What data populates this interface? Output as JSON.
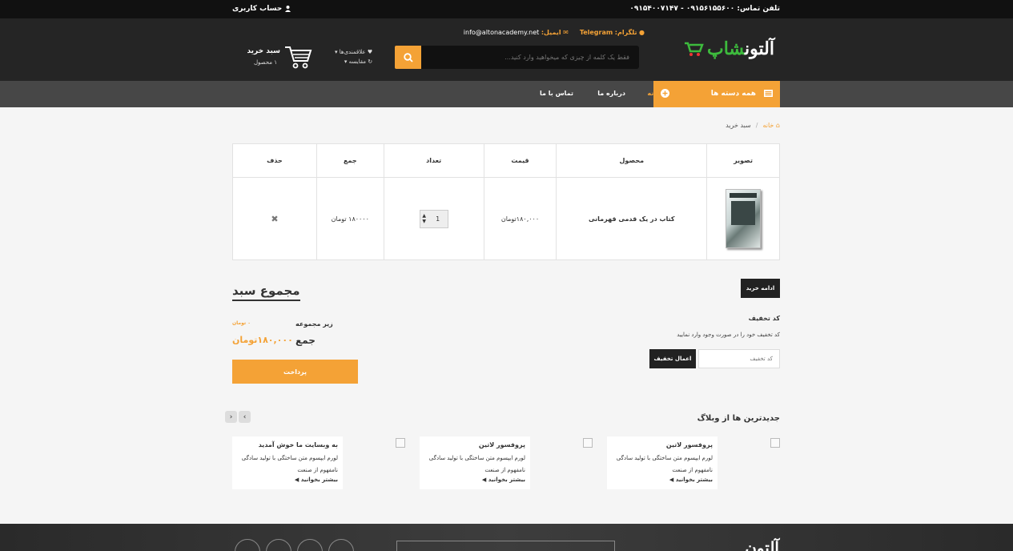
{
  "topbar": {
    "phone": "تلفن تماس: ۰۹۱۵۶۱۵۵۶۰۰ - ۰۹۱۵۴۰۰۷۱۴۷",
    "account": "حساب کاربری"
  },
  "header": {
    "logo_main": "آلتون",
    "logo_accent": "شاپ",
    "telegram_label": "تلگرام:",
    "telegram_value": "Telegram",
    "email_label": "ایمیل:",
    "email_value": "info@altonacademy.net",
    "search_placeholder": "فقط یک کلمه از چیزی که میخواهید وارد کنید...",
    "wishlist": "علاقمندی‌ها",
    "compare": "مقایسه",
    "cart_title": "سبد خرید",
    "cart_count": "۱ محصول"
  },
  "nav": {
    "all_categories": "همه دسته ها",
    "home": "خانه",
    "about": "درباره ما",
    "contact": "تماس با ما"
  },
  "breadcrumb": {
    "home": "خانه",
    "separator": "/",
    "current": "سبد خرید"
  },
  "cart_table": {
    "headers": {
      "image": "تصویر",
      "product": "محصول",
      "price": "قیمت",
      "quantity": "تعداد",
      "total": "جمع",
      "remove": "حذف"
    },
    "row": {
      "product": "کتاب در یک قدمی قهرمانی",
      "price": "۱۸۰,۰۰۰تومان",
      "quantity": "1",
      "total": "۱۸۰۰۰۰ تومان",
      "remove_glyph": "✖"
    }
  },
  "totals": {
    "title": "مجموع سبد",
    "subtotal_label": "زیر مجموعه",
    "subtotal_value": "۰ تومان",
    "total_label": "جمع",
    "total_value": "۱۸۰,۰۰۰تومان",
    "pay": "پرداخت"
  },
  "coupon": {
    "continue": "ادامه خرید",
    "title": "کد تخفیف",
    "desc": "کد تخفیف خود را در صورت وجود وارد نمایید",
    "placeholder": "کد تخفیف",
    "submit": "اعمال تخفیف"
  },
  "blog": {
    "title": "جدیدترین ها از وبلاگ",
    "posts": [
      {
        "title": "پروفسور لاتین",
        "line1": "لورم ایپسوم متن ساختگی با تولید سادگی",
        "line2": "نامفهوم از صنعت",
        "more": "بیشتر بخوانید"
      },
      {
        "title": "پروفسور لاتین",
        "line1": "لورم ایپسوم متن ساختگی با تولید سادگی",
        "line2": "نامفهوم از صنعت",
        "more": "بیشتر بخوانید"
      },
      {
        "title": "به وبسایت ما خوش آمدید",
        "line1": "لورم ایپسوم متن ساختگی با تولید سادگی",
        "line2": "نامفهوم از صنعت",
        "more": "بیشتر بخوانید"
      }
    ]
  },
  "colors": {
    "accent": "#f4a236",
    "dark": "#252525",
    "nav": "#474747",
    "logo_green": "#3dbb3d"
  }
}
